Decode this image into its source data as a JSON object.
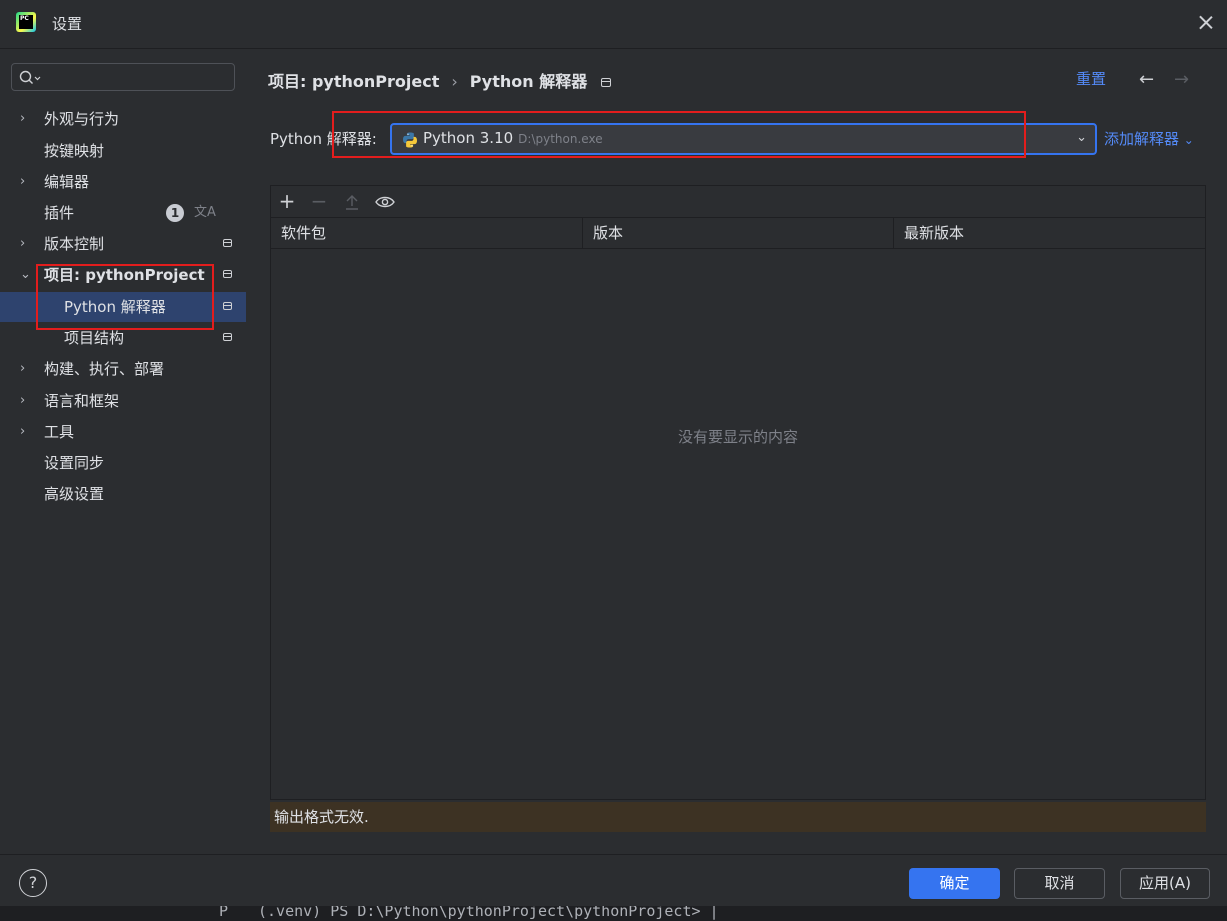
{
  "window": {
    "title": "设置",
    "app_icon_text": "PC"
  },
  "search": {
    "placeholder": ""
  },
  "sidebar": {
    "items": [
      {
        "label": "外观与行为",
        "chevron": "›"
      },
      {
        "label": "按键映射"
      },
      {
        "label": "编辑器",
        "chevron": "›"
      },
      {
        "label": "插件",
        "badge": "1",
        "extra_icon": "translate-icon"
      },
      {
        "label": "版本控制",
        "chevron": "›"
      },
      {
        "label": "项目: pythonProject",
        "chevron": "⌄"
      },
      {
        "label": "Python 解释器"
      },
      {
        "label": "项目结构"
      },
      {
        "label": "构建、执行、部署",
        "chevron": "›"
      },
      {
        "label": "语言和框架",
        "chevron": "›"
      },
      {
        "label": "工具",
        "chevron": "›"
      },
      {
        "label": "设置同步"
      },
      {
        "label": "高级设置"
      }
    ]
  },
  "breadcrumb": {
    "project": "项目: pythonProject",
    "separator": "›",
    "current": "Python 解释器"
  },
  "header": {
    "reset": "重置",
    "back": "←",
    "forward": "→"
  },
  "interpreter": {
    "label": "Python 解释器:",
    "name": "Python 3.10",
    "path": "D:\\python.exe",
    "add": "添加解释器"
  },
  "packages": {
    "toolbar": [
      "add-icon",
      "remove-icon",
      "upgrade-icon",
      "eye-icon"
    ],
    "columns": [
      "软件包",
      "版本",
      "最新版本"
    ],
    "empty_text": "没有要显示的内容",
    "warning": "输出格式无效."
  },
  "footer": {
    "help": "?",
    "ok": "确定",
    "cancel": "取消",
    "apply": "应用(A)"
  },
  "terminal": {
    "prefix": "P",
    "command": "(.venv) PS D:\\Python\\pythonProject\\pythonProject> |"
  },
  "colors": {
    "accent": "#3574f0",
    "link": "#548af7",
    "highlight": "#e31d1d",
    "selection": "#2e436e",
    "warning_bg": "#3d3223"
  }
}
